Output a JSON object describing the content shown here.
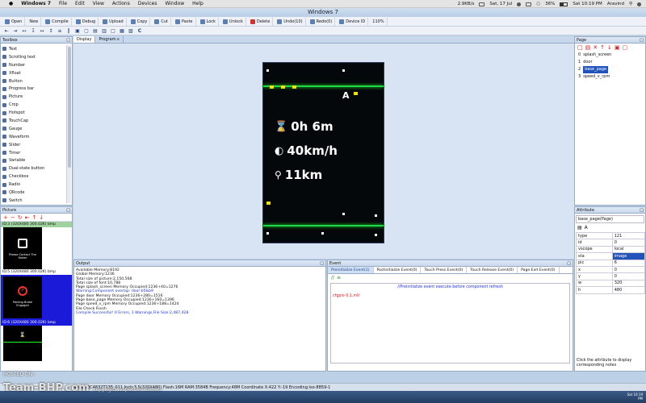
{
  "macbar": {
    "apple": "",
    "app": "Windows 7",
    "menus": [
      "File",
      "Edit",
      "View",
      "Actions",
      "Devices",
      "Window",
      "Help"
    ],
    "net": "2.9KB/s",
    "date": "Sat, 17 Jul",
    "battery": "36%",
    "time": "Sat 10:19 PM",
    "user": "Aravind"
  },
  "window_title": "Windows 7",
  "toolbar1": [
    "Open",
    "New",
    "Compile",
    "Debug",
    "Upload",
    "Copy",
    "Cut",
    "Paste",
    "Lock",
    "Unlock",
    "Delete",
    "Undo(10)",
    "Redo(0)",
    "Device ID",
    "110%"
  ],
  "toolbar2_icons": [
    "align-left",
    "align-right",
    "align-top",
    "align-bottom",
    "same-width",
    "same-height",
    "h-distribute",
    "v-distribute",
    "bring-front",
    "send-back",
    "center-h",
    "center-v",
    "same-size",
    "grid",
    "snap",
    "bold-c"
  ],
  "toolbox": {
    "title": "Toolbox",
    "items": [
      "Text",
      "Scrolling text",
      "Number",
      "Xfloat",
      "Button",
      "Progress bar",
      "Picture",
      "Crop",
      "Hotspot",
      "TouchCap",
      "Gauge",
      "Waveform",
      "Slider",
      "Timer",
      "Variable",
      "Dual-state button",
      "Checkbox",
      "Radio",
      "QRcode",
      "Switch"
    ]
  },
  "picture": {
    "title": "Picture",
    "thumbs": [
      {
        "id": "ID:3",
        "info": "(320X480 300.02K) bmp",
        "caption": "Please Contact The\nMaker"
      },
      {
        "id": "ID:5",
        "info": "(320X480 300.02K) bmp",
        "caption": "Parking Brake\nEngaged"
      },
      {
        "id": "ID:6",
        "info": "(320X480 300.02K) bmp",
        "caption": ""
      }
    ]
  },
  "display": {
    "tabs": [
      "Display",
      "Program.s"
    ],
    "screen": {
      "time": "0h 6m",
      "speed": "40km/h",
      "distance": "11km",
      "compass": "A"
    }
  },
  "output": {
    "title": "Output",
    "lines": [
      {
        "text": "Available Memory:8192",
        "color": "#111"
      },
      {
        "text": "Global Memory:1236",
        "color": "#111"
      },
      {
        "text": "Total size of picture:2,150,568",
        "color": "#111"
      },
      {
        "text": "Total size of font:10,788",
        "color": "#111"
      },
      {
        "text": "Page splash_screen Memory Occupied:1236+40=1276",
        "color": "#111"
      },
      {
        "text": "Warning:Component overlap: door:b5&b9",
        "color": "#2233cc"
      },
      {
        "text": "Page door Memory Occupied:1236+280=1516",
        "color": "#111"
      },
      {
        "text": "Page base_page Memory Occupied:1236+160=1396",
        "color": "#111"
      },
      {
        "text": "Page speed_v_rpm Memory Occupied:1236+188=1424",
        "color": "#111"
      },
      {
        "text": "File Check Finish",
        "color": "#111"
      },
      {
        "text": "Compile Successful! 0 Errors, 1 Warnings,File Size:2,487,428",
        "color": "#2233cc"
      }
    ]
  },
  "event": {
    "title": "Event",
    "tabs": [
      "Preinitialize Event(1)",
      "Postinitialize Event(0)",
      "Touch Press Event(0)",
      "Touch Release Event(0)",
      "Page Exit Event(0)"
    ],
    "comment": "//Preinitialize event execute before component refresh",
    "code": "cfgpio 0,1,m0"
  },
  "page": {
    "title": "Page",
    "items": [
      {
        "idx": "0",
        "name": "splash_screen"
      },
      {
        "idx": "1",
        "name": "door"
      },
      {
        "idx": "2",
        "name": "base_page"
      },
      {
        "idx": "3",
        "name": "speed_v_rpm"
      }
    ],
    "selected": 2
  },
  "attribute": {
    "title": "Attribute",
    "object": "base_page(Page)",
    "rows": [
      [
        "type",
        "121"
      ],
      [
        "id",
        "0"
      ],
      [
        "vscope",
        "local"
      ],
      [
        "sta",
        "image"
      ],
      [
        "pic",
        "6"
      ],
      [
        "x",
        "0"
      ],
      [
        "y",
        "0"
      ],
      [
        "w",
        "320"
      ],
      [
        "h",
        "480"
      ]
    ],
    "hint": "Click the attribute to display corresponding notes"
  },
  "status": {
    "text": "Model:TJC4832T135_011  Inch:3.5(320X480)  Flash:16M  RAM:3584B  Frequency:48M    Coordinate X:422  Y:-19",
    "encoding": "Encoding:iso-8859-1"
  },
  "watermark": {
    "text": "Team-BHP.com",
    "tag": "copyright respective owners",
    "hosted": "HOSTED ON :"
  }
}
